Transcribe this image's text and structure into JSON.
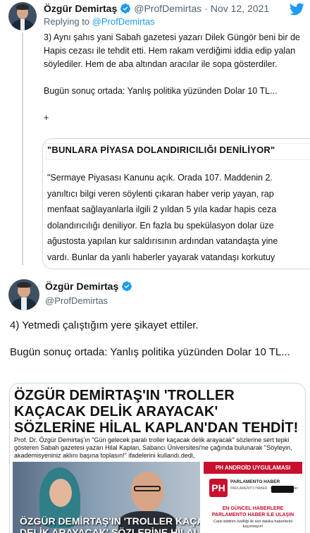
{
  "reply_tweet": {
    "author_name": "Özgür Demirtaş",
    "handle": "@ProfDemirtas",
    "separator": "·",
    "date": "Nov 12, 2021",
    "replying_prefix": "Replying to",
    "replying_to": "@ProfDemirtas",
    "paragraphs": [
      "3) Aynı şahıs yani Sabah gazetesi yazarı Dilek Güngör beni bir de Hapis cezası ile tehdit etti. Hem rakam verdiğimi iddia edip yalan söylediler. Hem de aba altından aracılar ile sopa gösterdiler.",
      "Bugün sonuç ortada: Yanlış politika yüzünden Dolar 10 TL...",
      "+"
    ],
    "image": {
      "title": "\"BUNLARA PİYASA DOLANDIRICILIĞI DENİLİYOR\"",
      "lines": [
        "\"Sermaye Piyasası Kanunu açık. Orada 107. Maddenin 2.",
        "yanıltıcı bilgi veren söylenti çıkaran haber verip yayan, rap",
        "menfaat sağlayanlarla ilgili 2 yıldan 5 yıla kadar hapis ceza",
        "dolandırıcılığı deniliyor. En fazla bu spekülasyon dolar üze",
        "ağustosta yapılan kur saldırısının ardından vatandaşta yine",
        "vardı. Bunlar da yanlı haberler yayarak vatandaşı korkutuy"
      ]
    }
  },
  "main_tweet": {
    "author_name": "Özgür Demirtaş",
    "handle": "@ProfDemirtas",
    "paragraphs": [
      "4) Yetmedi çalıştığım yere şikayet ettiler.",
      "Bugün sonuç ortada: Yanlış politika yüzünden Dolar 10 TL..."
    ],
    "article": {
      "headline": "ÖZGÜR DEMİRTAŞ'IN 'TROLLER KAÇACAK DELİK ARAYACAK' SÖZLERİNE HİLAL KAPLAN'DAN TEHDİT!",
      "lede": "Prof. Dr. Özgür Demirtaş'ın \"Gün gelecek paralı troller kaçacak delik arayacak\" sözlerine sert tepki gösteren Sabah gazetesi yazarı Hilal Kaplan, Sabancı Üniversitesi'ne çağında bulunarak \"Söyleyin, akademisyeniniz aklını başına toplasın!\" ifadelerini kullandı.dedi,",
      "photo_caption_line1": "ÖZGÜR DEMİRTAŞ'IN 'TROLLER KAÇACAK",
      "photo_caption_line2": "DELİK ARAYACAK' SÖZLERİNE HİLAL KAPLAN'DAN",
      "ad": {
        "top_label": "PH ANDROİD UYGULAMASI",
        "logo": "PH",
        "brand": "PARLAMENTO HABER",
        "sub": "PARLAMENTO HABER · Haber ve Dergiler",
        "line1": "EN GÜNCEL HABERLERE PARLAMENTO HABER İLE ULAŞIN",
        "line2": "Canlı bildirim özelliği ile son dakika haberlerini kaçırmayın!"
      }
    }
  },
  "colors": {
    "accent": "#1d9bf0",
    "text": "#0f1419",
    "secondary": "#536471",
    "border": "#cfd9de"
  },
  "icons": [
    "verified-badge-icon",
    "twitter-bird-icon"
  ]
}
